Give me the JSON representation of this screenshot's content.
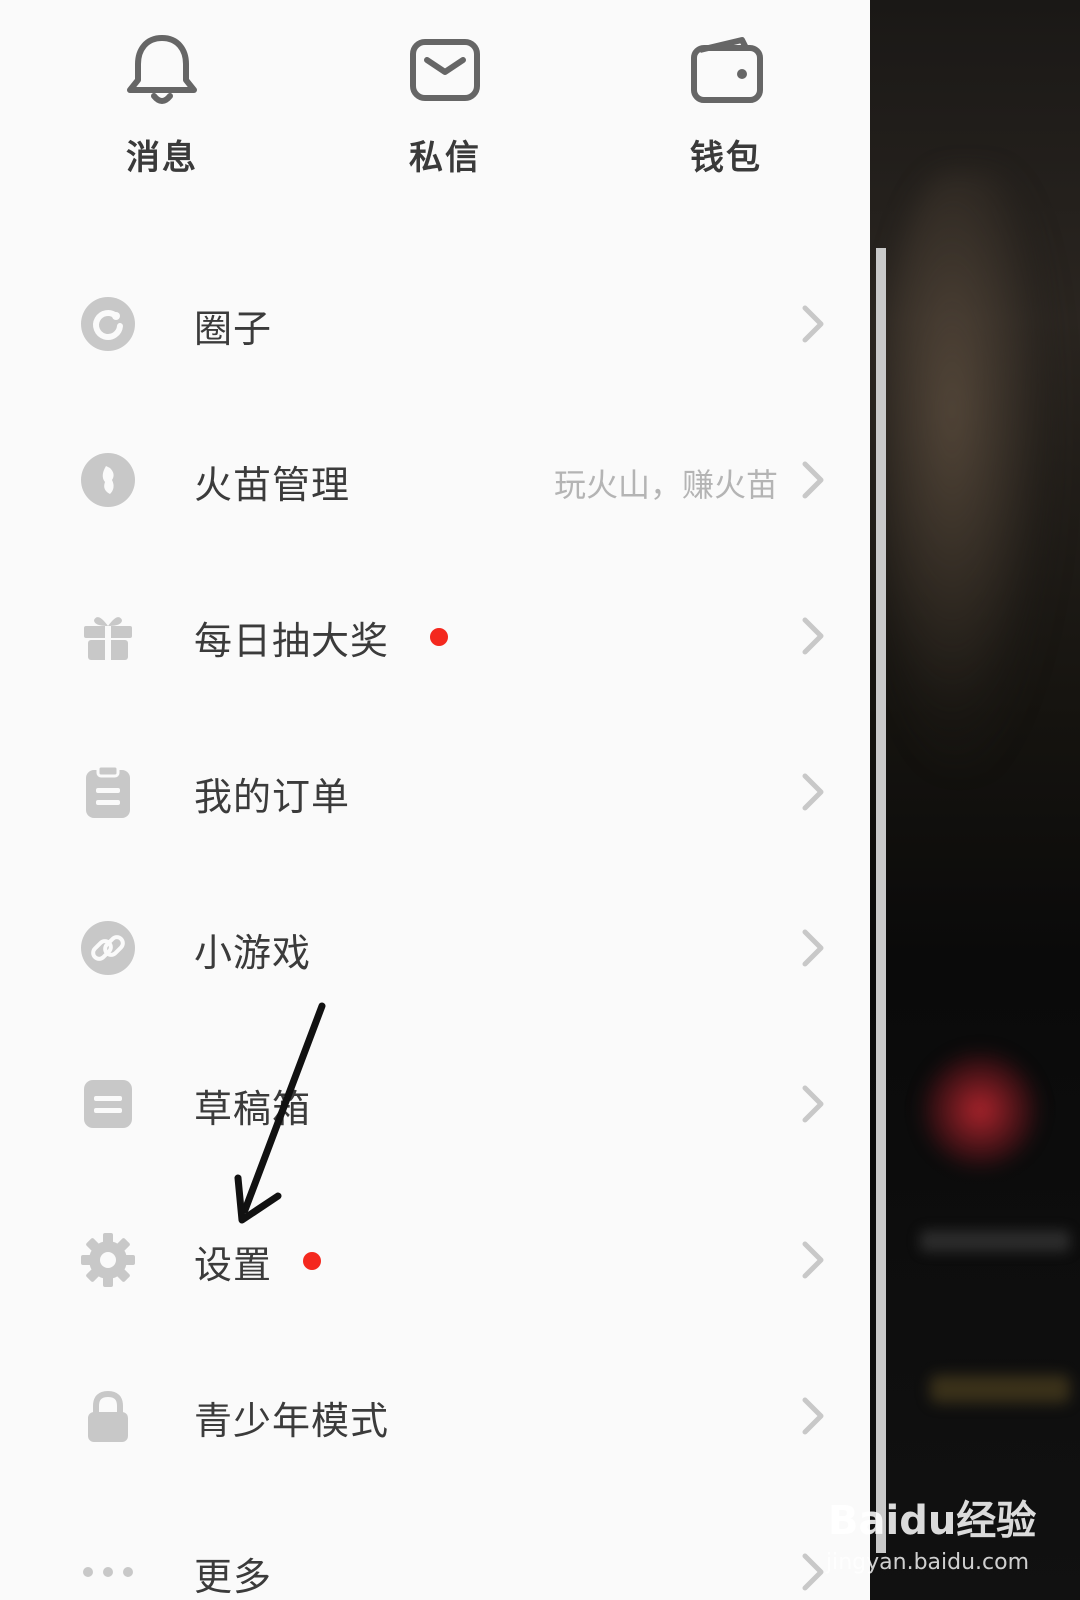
{
  "top_actions": [
    {
      "label": "消息",
      "icon": "bell-icon"
    },
    {
      "label": "私信",
      "icon": "mail-icon"
    },
    {
      "label": "钱包",
      "icon": "wallet-icon"
    }
  ],
  "menu": [
    {
      "label": "圈子",
      "icon": "circle-refresh-icon",
      "hint": "",
      "badge": false
    },
    {
      "label": "火苗管理",
      "icon": "flame-icon",
      "hint": "玩火山，赚火苗",
      "badge": false
    },
    {
      "label": "每日抽大奖",
      "icon": "gift-icon",
      "hint": "",
      "badge": true
    },
    {
      "label": "我的订单",
      "icon": "clipboard-icon",
      "hint": "",
      "badge": false
    },
    {
      "label": "小游戏",
      "icon": "link-icon",
      "hint": "",
      "badge": false
    },
    {
      "label": "草稿箱",
      "icon": "drafts-icon",
      "hint": "",
      "badge": false
    },
    {
      "label": "设置",
      "icon": "gear-icon",
      "hint": "",
      "badge": true
    },
    {
      "label": "青少年模式",
      "icon": "lock-icon",
      "hint": "",
      "badge": false
    },
    {
      "label": "更多",
      "icon": "more-dots-icon",
      "hint": "",
      "badge": false
    }
  ],
  "colors": {
    "badge": "#f4281e",
    "icon_gray": "#c8c8c8",
    "text": "#3b3b3b",
    "hint": "#b4b4b4"
  },
  "watermark": {
    "main": "Baidu经验",
    "sub": "jingyan.baidu.com"
  }
}
